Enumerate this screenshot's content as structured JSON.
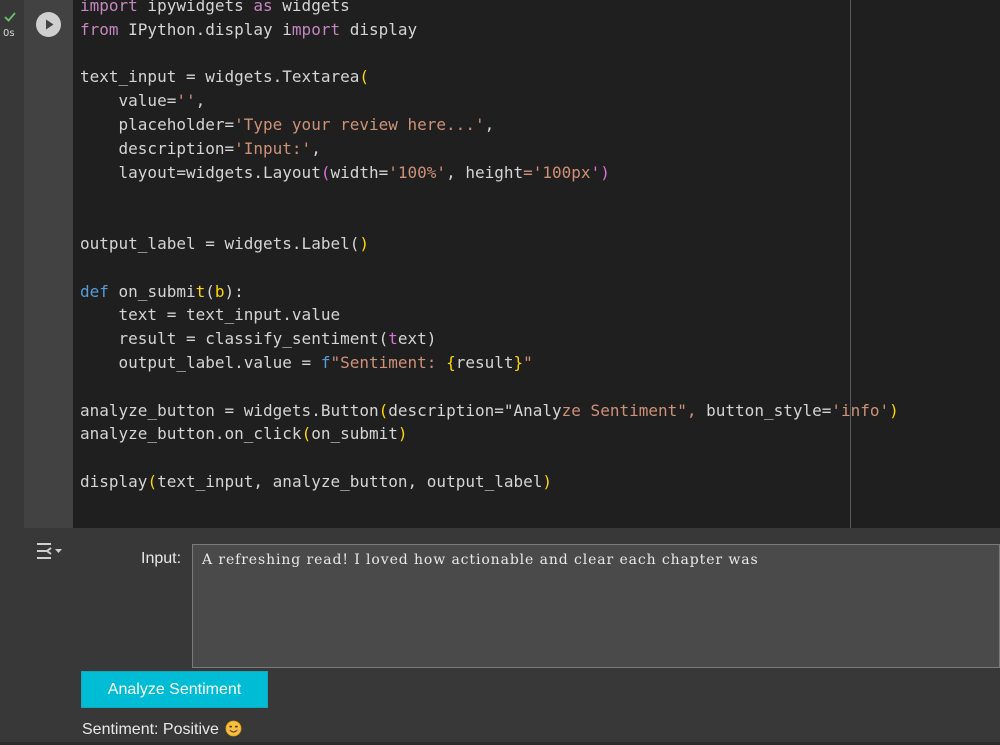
{
  "cell": {
    "run_time": "0s",
    "status_icon": "check-icon",
    "run_icon": "play-icon"
  },
  "code_lines": [
    "import ipywidgets as widgets",
    "from IPython.display import display",
    "",
    "text_input = widgets.Textarea(",
    "    value='',",
    "    placeholder='Type your review here...',",
    "    description='Input:',",
    "    layout=widgets.Layout(width='100%', height='100px')",
    ")",
    "",
    "output_label = widgets.Label()",
    "",
    "def on_submit(b):",
    "    text = text_input.value",
    "    result = classify_sentiment(text)",
    "    output_label.value = f\"Sentiment: {result}\"",
    "",
    "analyze_button = widgets.Button(description=\"Analyze Sentiment\", button_style='info')",
    "analyze_button.on_click(on_submit)",
    "",
    "display(text_input, analyze_button, output_label)"
  ],
  "output": {
    "input_label": "Input:",
    "textarea_value": "A refreshing read! I loved how actionable and clear each chapter was",
    "button_label": "Analyze Sentiment",
    "sentiment_text": "Sentiment: Positive",
    "emoji_icon": "smiling-face-icon",
    "output_toggle_icon": "output-options-icon"
  },
  "colors": {
    "button": "#00bcd4",
    "code_bg": "#1f1f1f",
    "keyword": "#c586c0",
    "def": "#569cd6",
    "string": "#ce9178"
  }
}
